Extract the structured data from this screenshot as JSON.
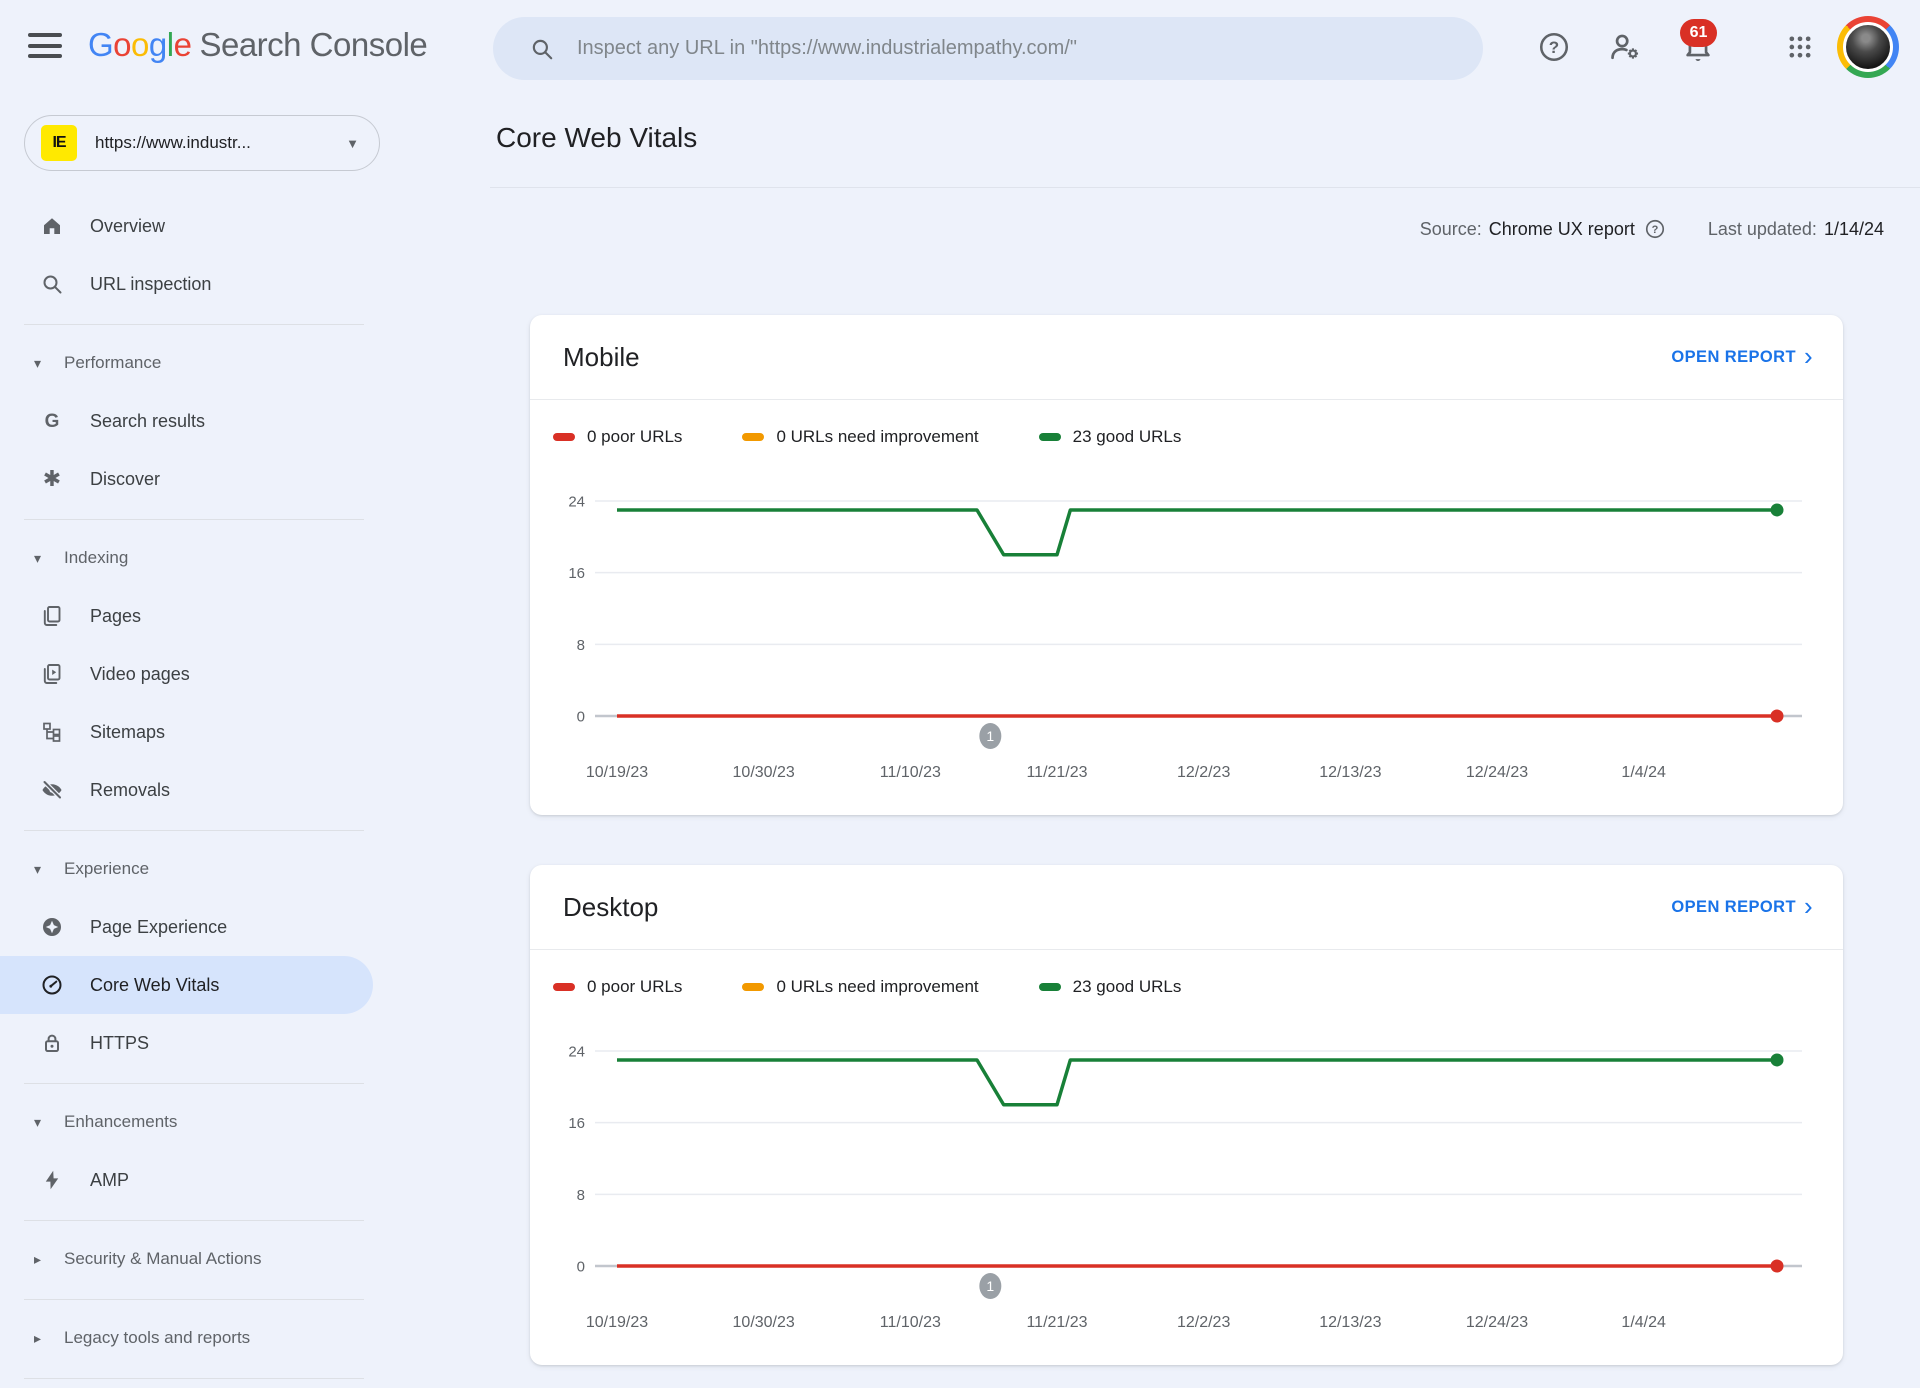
{
  "header": {
    "logo": {
      "letters": [
        [
          "G",
          "#4285F4"
        ],
        [
          "o",
          "#EA4335"
        ],
        [
          "o",
          "#FBBC05"
        ],
        [
          "g",
          "#4285F4"
        ],
        [
          "l",
          "#34A853"
        ],
        [
          "e",
          "#EA4335"
        ]
      ],
      "suffix": "Search Console"
    },
    "search": {
      "placeholder": "Inspect any URL in \"https://www.industrialempathy.com/\""
    },
    "actions": {
      "notification_count": "61"
    }
  },
  "sidebar": {
    "property": {
      "favicon_text": "IE",
      "url": "https://www.industr...",
      "caret": "▼"
    },
    "items": [
      {
        "label": "Overview",
        "icon": "home-icon"
      },
      {
        "label": "URL inspection",
        "icon": "search-icon"
      },
      {
        "label": "Performance",
        "type": "section",
        "caret": "▾"
      },
      {
        "label": "Search results",
        "icon": "google-g-icon"
      },
      {
        "label": "Discover",
        "icon": "discover-asterisk-icon"
      },
      {
        "label": "Indexing",
        "type": "section",
        "caret": "▾"
      },
      {
        "label": "Pages",
        "icon": "pages-icon"
      },
      {
        "label": "Video pages",
        "icon": "video-pages-icon"
      },
      {
        "label": "Sitemaps",
        "icon": "sitemaps-icon"
      },
      {
        "label": "Removals",
        "icon": "removals-eye-off-icon"
      },
      {
        "label": "Experience",
        "type": "section",
        "caret": "▾"
      },
      {
        "label": "Page Experience",
        "icon": "page-experience-icon"
      },
      {
        "label": "Core Web Vitals",
        "icon": "core-web-vitals-icon",
        "selected": true
      },
      {
        "label": "HTTPS",
        "icon": "lock-icon"
      },
      {
        "label": "Enhancements",
        "type": "section",
        "caret": "▾"
      },
      {
        "label": "AMP",
        "icon": "amp-bolt-icon"
      },
      {
        "label": "Security & Manual Actions",
        "type": "section",
        "caret": "▸"
      },
      {
        "label": "Legacy tools and reports",
        "type": "section",
        "caret": "▸"
      }
    ]
  },
  "page": {
    "title": "Core Web Vitals",
    "source_label": "Source:",
    "source_value": "Chrome UX report",
    "updated_label": "Last updated:",
    "updated_value": "1/14/24"
  },
  "cards": [
    {
      "title": "Mobile",
      "open_report_label": "OPEN REPORT",
      "chevron": "›",
      "legend": [
        {
          "label": "0 poor URLs",
          "color": "#d93025"
        },
        {
          "label": "0 URLs need improvement",
          "color": "#f29900"
        },
        {
          "label": "23 good URLs",
          "color": "#188038"
        }
      ]
    },
    {
      "title": "Desktop",
      "open_report_label": "OPEN REPORT",
      "chevron": "›",
      "legend": [
        {
          "label": "0 poor URLs",
          "color": "#d93025"
        },
        {
          "label": "0 URLs need improvement",
          "color": "#f29900"
        },
        {
          "label": "23 good URLs",
          "color": "#188038"
        }
      ]
    }
  ],
  "chart_data": [
    {
      "type": "line",
      "title": "Mobile Core Web Vitals URLs over time",
      "x_unit": "days since 10/19/23",
      "x_max": 87,
      "x_ticks": [
        {
          "day": 0,
          "label": "10/19/23"
        },
        {
          "day": 11,
          "label": "10/30/23"
        },
        {
          "day": 22,
          "label": "11/10/23"
        },
        {
          "day": 33,
          "label": "11/21/23"
        },
        {
          "day": 44,
          "label": "12/2/23"
        },
        {
          "day": 55,
          "label": "12/13/23"
        },
        {
          "day": 66,
          "label": "12/24/23"
        },
        {
          "day": 77,
          "label": "1/4/24"
        }
      ],
      "ylim": [
        0,
        24
      ],
      "y_ticks": [
        0,
        8,
        16,
        24
      ],
      "grid": true,
      "legend_position": "top",
      "series": [
        {
          "name": "good URLs",
          "color": "#188038",
          "end_dot": true,
          "points": [
            [
              0,
              23
            ],
            [
              27,
              23
            ],
            [
              29,
              18
            ],
            [
              33,
              18
            ],
            [
              34,
              23
            ],
            [
              87,
              23
            ]
          ]
        },
        {
          "name": "poor URLs",
          "color": "#d93025",
          "end_dot": true,
          "points": [
            [
              0,
              0
            ],
            [
              87,
              0
            ]
          ]
        }
      ],
      "annotations": [
        {
          "day": 28,
          "label": "1"
        }
      ]
    },
    {
      "type": "line",
      "title": "Desktop Core Web Vitals URLs over time",
      "x_unit": "days since 10/19/23",
      "x_max": 87,
      "x_ticks": [
        {
          "day": 0,
          "label": "10/19/23"
        },
        {
          "day": 11,
          "label": "10/30/23"
        },
        {
          "day": 22,
          "label": "11/10/23"
        },
        {
          "day": 33,
          "label": "11/21/23"
        },
        {
          "day": 44,
          "label": "12/2/23"
        },
        {
          "day": 55,
          "label": "12/13/23"
        },
        {
          "day": 66,
          "label": "12/24/23"
        },
        {
          "day": 77,
          "label": "1/4/24"
        }
      ],
      "ylim": [
        0,
        24
      ],
      "y_ticks": [
        0,
        8,
        16,
        24
      ],
      "grid": true,
      "legend_position": "top",
      "series": [
        {
          "name": "good URLs",
          "color": "#188038",
          "end_dot": true,
          "points": [
            [
              0,
              23
            ],
            [
              27,
              23
            ],
            [
              29,
              18
            ],
            [
              33,
              18
            ],
            [
              34,
              23
            ],
            [
              87,
              23
            ]
          ]
        },
        {
          "name": "poor URLs",
          "color": "#d93025",
          "end_dot": true,
          "points": [
            [
              0,
              0
            ],
            [
              87,
              0
            ]
          ]
        }
      ],
      "annotations": [
        {
          "day": 28,
          "label": "1"
        }
      ]
    }
  ]
}
